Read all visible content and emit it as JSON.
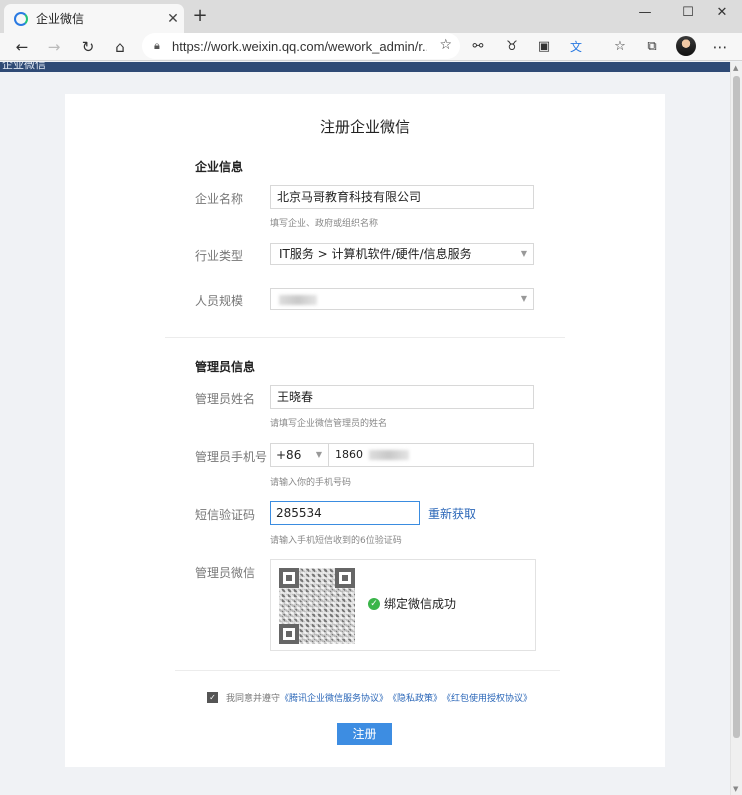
{
  "browser": {
    "tab_title": "企业微信",
    "url": "https://work.weixin.qq.com/wework_admin/r...",
    "icons": [
      "back-arrow-icon",
      "forward-arrow-icon",
      "refresh-icon",
      "home-icon",
      "lock-icon",
      "star-icon",
      "reading-icon",
      "extension-icon",
      "collections-icon",
      "translate-icon",
      "favorites-icon",
      "tabs-icon",
      "profile-avatar"
    ]
  },
  "header": {
    "brand": "企业微信"
  },
  "form": {
    "title": "注册企业微信",
    "company_section": "企业信息",
    "company_name_label": "企业名称",
    "company_name_value": "北京马哥教育科技有限公司",
    "company_name_hint": "填写企业、政府或组织名称",
    "industry_label": "行业类型",
    "industry_value": "IT服务 > 计算机软件/硬件/信息服务",
    "staff_size_label": "人员规模",
    "admin_section": "管理员信息",
    "admin_name_label": "管理员姓名",
    "admin_name_value": "王晓春",
    "admin_name_hint": "请填写企业微信管理员的姓名",
    "phone_label": "管理员手机号",
    "country_code": "+86",
    "phone_value": "1860",
    "phone_hint": "请输入你的手机号码",
    "sms_label": "短信验证码",
    "sms_value": "285534",
    "sms_resend": "重新获取",
    "sms_hint": "请输入手机短信收到的6位验证码",
    "wechat_label": "管理员微信",
    "bind_status": "绑定微信成功",
    "agree_text": "我同意并遵守",
    "agree_links": [
      "《腾讯企业微信服务协议》",
      "《隐私政策》",
      "《红包使用授权协议》"
    ],
    "submit_label": "注册"
  },
  "colors": {
    "accent": "#3d8de2",
    "link": "#2b67b8",
    "header": "#2f4a75",
    "success": "#3bb54a"
  }
}
